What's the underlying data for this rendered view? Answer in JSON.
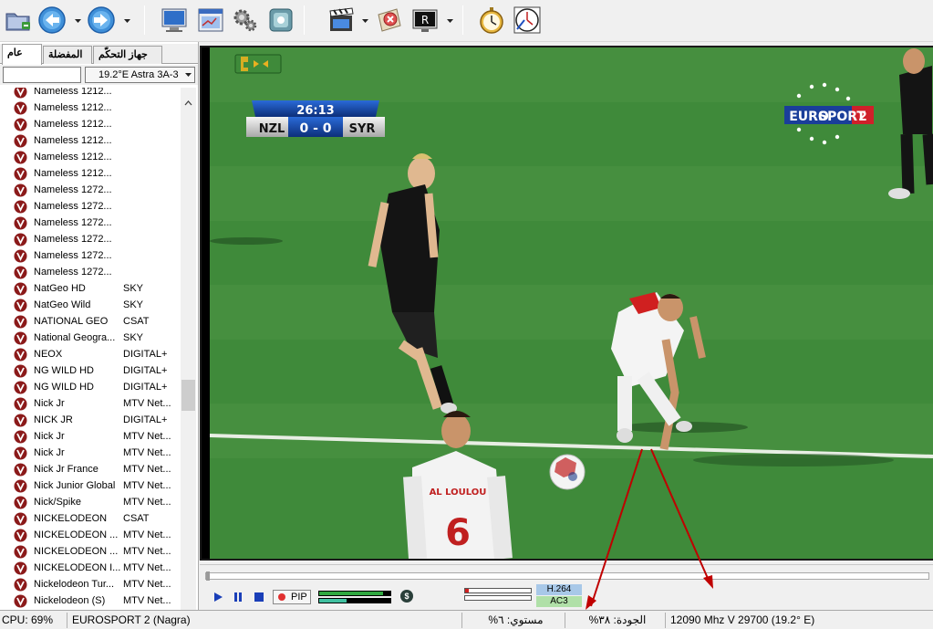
{
  "toolbar": {
    "buttons": [
      {
        "name": "open-folder-icon"
      },
      {
        "name": "back-icon"
      },
      {
        "name": "forward-icon"
      },
      {
        "name": "monitor-icon"
      },
      {
        "name": "window-icon"
      },
      {
        "name": "settings-gears-icon"
      },
      {
        "name": "scan-icon"
      },
      {
        "name": "clapperboard-icon"
      },
      {
        "name": "stop-record-icon"
      },
      {
        "name": "record-r-icon"
      },
      {
        "name": "stopwatch-icon"
      },
      {
        "name": "epg-clock-icon"
      }
    ],
    "record_label": "R"
  },
  "sidebar": {
    "tabs": [
      "عام",
      "المفضلة",
      "جهاز التحكّم"
    ],
    "active_tab": 0,
    "satellite": "19.2°E Astra 3A-3",
    "channels": [
      {
        "name": "Nameless 1212...",
        "provider": ""
      },
      {
        "name": "Nameless 1212...",
        "provider": ""
      },
      {
        "name": "Nameless 1212...",
        "provider": ""
      },
      {
        "name": "Nameless 1212...",
        "provider": ""
      },
      {
        "name": "Nameless 1212...",
        "provider": ""
      },
      {
        "name": "Nameless 1212...",
        "provider": ""
      },
      {
        "name": "Nameless 1272...",
        "provider": ""
      },
      {
        "name": "Nameless 1272...",
        "provider": ""
      },
      {
        "name": "Nameless 1272...",
        "provider": ""
      },
      {
        "name": "Nameless 1272...",
        "provider": ""
      },
      {
        "name": "Nameless 1272...",
        "provider": ""
      },
      {
        "name": "Nameless 1272...",
        "provider": ""
      },
      {
        "name": "NatGeo HD",
        "provider": "SKY"
      },
      {
        "name": "NatGeo Wild",
        "provider": "SKY"
      },
      {
        "name": "NATIONAL GEO",
        "provider": "CSAT"
      },
      {
        "name": "National Geogra...",
        "provider": "SKY"
      },
      {
        "name": "NEOX",
        "provider": "DIGITAL+"
      },
      {
        "name": "NG WILD HD",
        "provider": "DIGITAL+"
      },
      {
        "name": "NG WILD HD",
        "provider": "DIGITAL+"
      },
      {
        "name": "Nick Jr",
        "provider": "MTV Net..."
      },
      {
        "name": "NICK JR",
        "provider": "DIGITAL+"
      },
      {
        "name": "Nick Jr",
        "provider": "MTV Net..."
      },
      {
        "name": "Nick Jr",
        "provider": "MTV Net..."
      },
      {
        "name": "Nick Jr France",
        "provider": "MTV Net..."
      },
      {
        "name": "Nick Junior Global",
        "provider": "MTV Net..."
      },
      {
        "name": "Nick/Spike",
        "provider": "MTV Net..."
      },
      {
        "name": "NICKELODEON",
        "provider": "CSAT"
      },
      {
        "name": "NICKELODEON ...",
        "provider": "MTV Net..."
      },
      {
        "name": "NICKELODEON ...",
        "provider": "MTV Net..."
      },
      {
        "name": "NICKELODEON I...",
        "provider": "MTV Net..."
      },
      {
        "name": "Nickelodeon Tur...",
        "provider": "MTV Net..."
      },
      {
        "name": "Nickelodeon (S)",
        "provider": "MTV Net..."
      }
    ]
  },
  "video": {
    "score_time": "26:13",
    "team_home": "NZL",
    "team_away": "SYR",
    "score": "0 - 0",
    "channel_logo_top": "EURO",
    "channel_logo_bottom": "SPORT",
    "channel_logo_num": "2",
    "player_name": "AL LOULOU",
    "player_number": "6"
  },
  "controls": {
    "pip_label": "PIP",
    "video_codec": "H.264",
    "audio_codec": "AC3",
    "signal_level_pct": 0.9,
    "signal_quality_pct": 0.38,
    "level_bar_pct": 0.06
  },
  "status": {
    "cpu": "CPU: 69%",
    "channel": "EUROSPORT 2 (Nagra)",
    "level": "%مستوي: ٦",
    "quality": "%الجودة: ٣٨",
    "tuning": "12090 Mhz  V  29700  (19.2° E)"
  },
  "colors": {
    "pitch": "#3f8a3a",
    "scoreboard": "#1a4fae",
    "arrow": "#c00000",
    "channel_icon": "#8b1a1a"
  }
}
